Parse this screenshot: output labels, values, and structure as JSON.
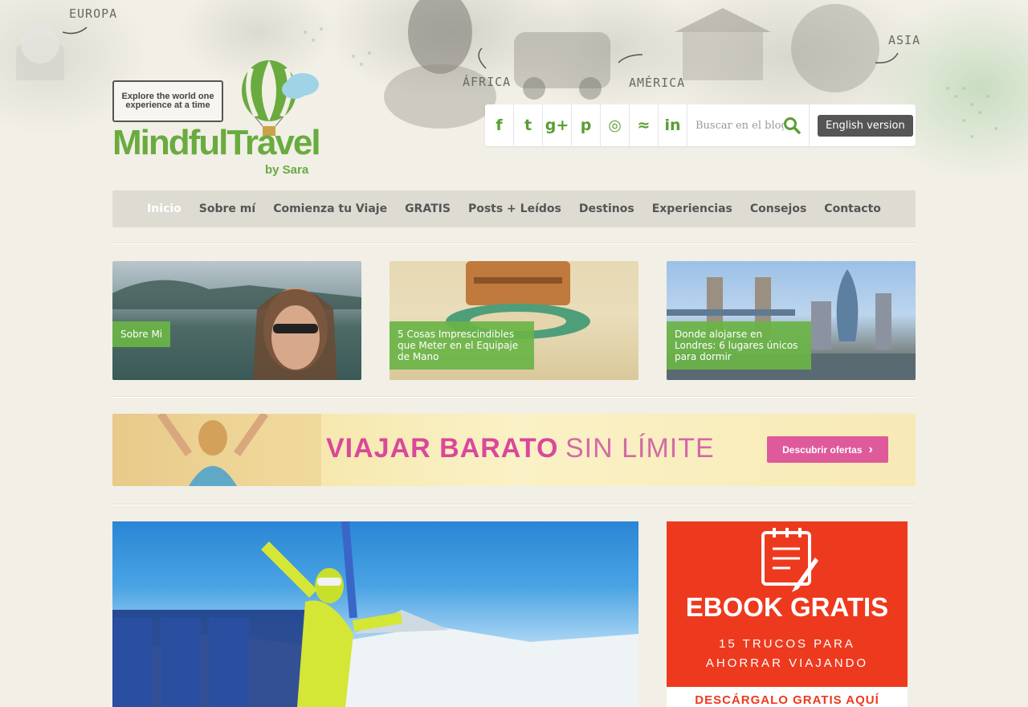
{
  "map_labels": {
    "europa": "EUROPA",
    "africa": "ÁFRICA",
    "america": "AMÉRICA",
    "asia": "ASIA"
  },
  "logo": {
    "tagline": "Explore the world one experience at a time",
    "brand": "MindfulTravel",
    "by": "by Sara"
  },
  "social": {
    "icons": [
      "facebook-icon",
      "twitter-icon",
      "google-plus-icon",
      "pinterest-icon",
      "instagram-icon",
      "rss-icon",
      "linkedin-icon"
    ],
    "glyphs": [
      "f",
      "t",
      "g+",
      "p",
      "◎",
      "≈",
      "in"
    ]
  },
  "search": {
    "placeholder": "Buscar en el blog"
  },
  "english_version": "English version",
  "nav": {
    "items": [
      "Inicio",
      "Sobre mí",
      "Comienza tu Viaje",
      "GRATIS",
      "Posts + Leídos",
      "Destinos",
      "Experiencias",
      "Consejos",
      "Contacto"
    ],
    "active": "Inicio"
  },
  "featured": [
    {
      "caption": "Sobre Mi"
    },
    {
      "caption": "5 Cosas Imprescindibles que Meter en el Equipaje de Mano"
    },
    {
      "caption": "Donde alojarse en Londres: 6 lugares únicos para dormir"
    }
  ],
  "banner": {
    "title_bold": "VIAJAR BARATO",
    "title_light": "SIN LÍMITE",
    "cta": "Descubrir ofertas"
  },
  "ebook": {
    "title": "EBOOK GRATIS",
    "subtitle_line1": "15 TRUCOS PARA",
    "subtitle_line2": "AHORRAR VIAJANDO",
    "footer": "DESCÁRGALO GRATIS AQUÍ"
  },
  "colors": {
    "brand_green": "#6aab3f",
    "banner_pink": "#d9489a",
    "ebook_red": "#ed3a1f",
    "nav_bg": "#dddbd2"
  }
}
